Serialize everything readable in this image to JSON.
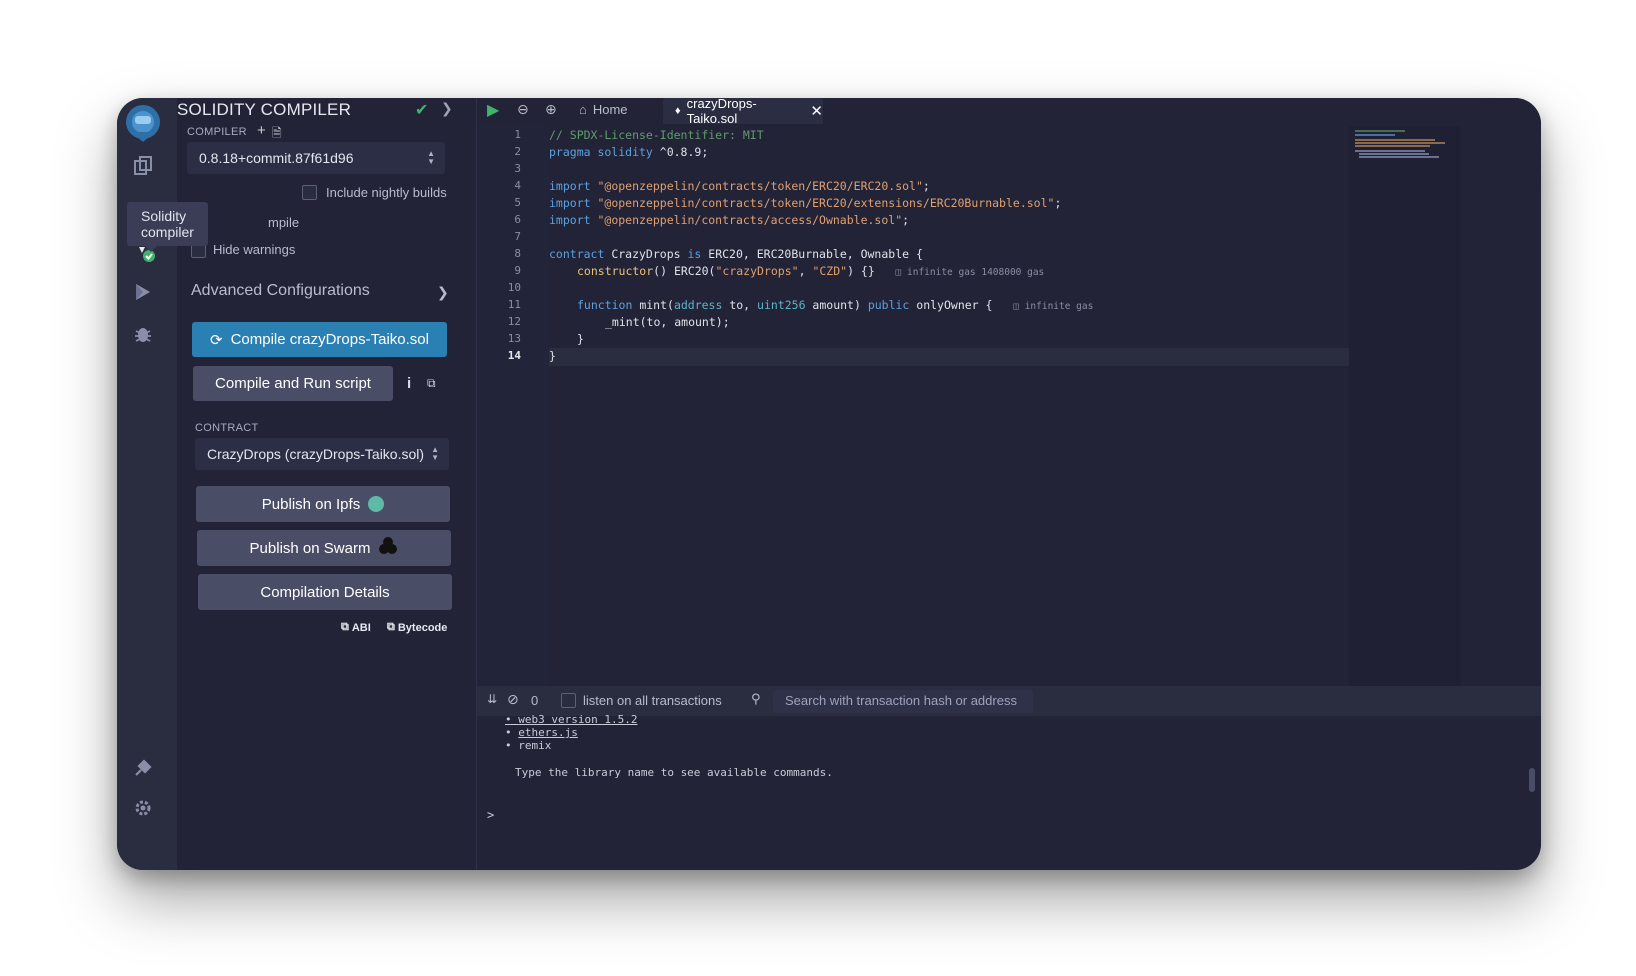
{
  "panel": {
    "title": "SOLIDITY COMPILER",
    "compiler_label": "COMPILER",
    "compiler_version": "0.8.18+commit.87f61d96",
    "include_nightly": "Include nightly builds",
    "auto_compile_partial": "mpile",
    "hide_warnings": "Hide warnings",
    "advanced": "Advanced Configurations",
    "compile_button": "Compile crazyDrops-Taiko.sol",
    "compile_run_button": "Compile and Run script",
    "contract_label": "CONTRACT",
    "contract_value": "CrazyDrops (crazyDrops-Taiko.sol)",
    "publish_ipfs": "Publish on Ipfs",
    "publish_swarm": "Publish on Swarm",
    "compilation_details": "Compilation Details",
    "abi": "ABI",
    "bytecode": "Bytecode"
  },
  "rail": {
    "tooltip": "Solidity compiler",
    "icons": [
      "remix-logo-icon",
      "file-explorer-icon",
      "solidity-compiler-icon",
      "deploy-run-icon",
      "debugger-icon",
      "plugin-manager-icon",
      "settings-icon"
    ]
  },
  "tabs": {
    "home": "Home",
    "file": "crazyDrops-Taiko.sol"
  },
  "editor": {
    "line_numbers": [
      "1",
      "2",
      "3",
      "4",
      "5",
      "6",
      "7",
      "8",
      "9",
      "10",
      "11",
      "12",
      "13",
      "14"
    ],
    "line1": "// SPDX-License-Identifier: MIT",
    "line2_k": "pragma solidity",
    "line2_v": " ^0.8.9;",
    "import_kw": "import",
    "line4_s": "\"@openzeppelin/contracts/token/ERC20/ERC20.sol\"",
    "line5_s": "\"@openzeppelin/contracts/token/ERC20/extensions/ERC20Burnable.sol\"",
    "line6_s": "\"@openzeppelin/contracts/access/Ownable.sol\"",
    "semi": ";",
    "line8_a": "contract",
    "line8_b": " CrazyDrops ",
    "line8_c": "is",
    "line8_d": " ERC20, ERC20Burnable, Ownable {",
    "line9_a": "constructor",
    "line9_b": "() ERC20(",
    "line9_s1": "\"crazyDrops\"",
    "line9_c": ", ",
    "line9_s2": "\"CZD\"",
    "line9_d": ") {}",
    "line9_gas": "infinite gas 1408000 gas",
    "line11_a": "function",
    "line11_b": " mint(",
    "line11_t1": "address",
    "line11_c": " to, ",
    "line11_t2": "uint256",
    "line11_d": " amount) ",
    "line11_e": "public",
    "line11_f": " onlyOwner {",
    "line11_gas": "infinite gas",
    "line12": "_mint(to, amount);",
    "line13": "}",
    "line14": "}"
  },
  "terminal": {
    "count": "0",
    "listen": "listen on all transactions",
    "search_placeholder": "Search with transaction hash or address",
    "web3_partial": "web3 version 1.5.2",
    "ethers": "ethers.js",
    "remix": "remix",
    "hint": "Type the library name to see available commands.",
    "prompt": ">"
  }
}
